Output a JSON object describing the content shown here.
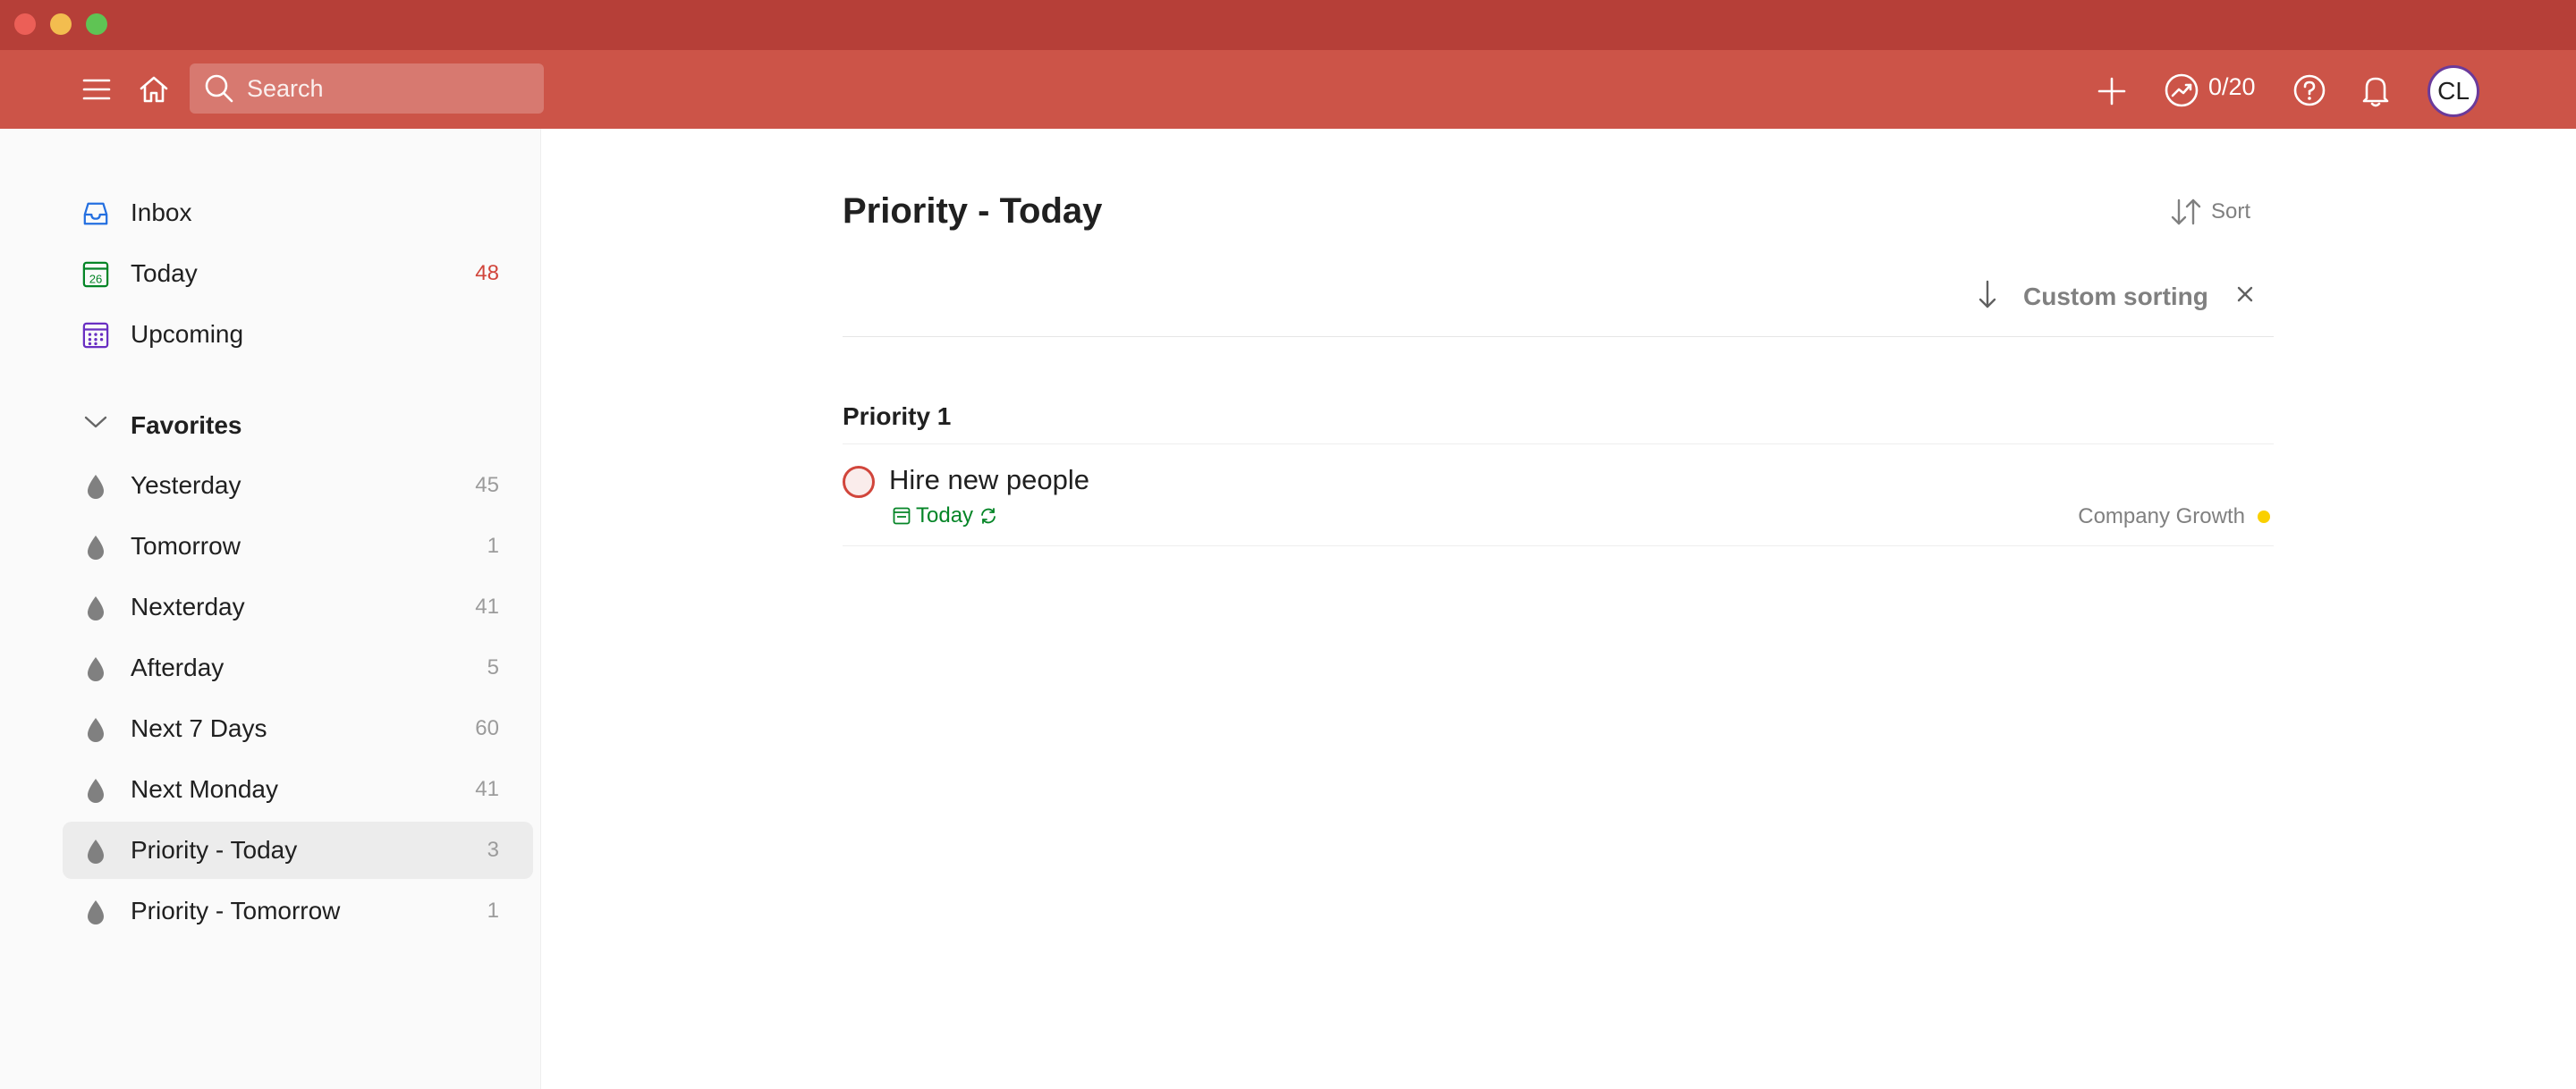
{
  "window": {
    "controls": [
      "close",
      "minimize",
      "zoom"
    ]
  },
  "toolbar": {
    "search_placeholder": "Search",
    "karma": "0/20",
    "avatar_initials": "CL",
    "icons": [
      "menu-icon",
      "home-icon",
      "search-icon",
      "plus-icon",
      "productivity-icon",
      "help-icon",
      "bell-icon"
    ]
  },
  "sidebar": {
    "top_items": [
      {
        "label": "Inbox",
        "count": "",
        "icon": "inbox-icon"
      },
      {
        "label": "Today",
        "count": "48",
        "icon": "calendar-today-icon",
        "day": "26"
      },
      {
        "label": "Upcoming",
        "count": "",
        "icon": "calendar-upcoming-icon"
      }
    ],
    "favorites_label": "Favorites",
    "favorites": [
      {
        "label": "Yesterday",
        "count": "45"
      },
      {
        "label": "Tomorrow",
        "count": "1"
      },
      {
        "label": "Nexterday",
        "count": "41"
      },
      {
        "label": "Afterday",
        "count": "5"
      },
      {
        "label": "Next 7 Days",
        "count": "60"
      },
      {
        "label": "Next Monday",
        "count": "41"
      },
      {
        "label": "Priority - Today",
        "count": "3",
        "active": true
      },
      {
        "label": "Priority - Tomorrow",
        "count": "1"
      }
    ]
  },
  "main": {
    "title": "Priority - Today",
    "sort_label": "Sort",
    "custom_sorting_label": "Custom sorting",
    "sections": [
      {
        "title": "Priority 1",
        "tasks": [
          {
            "name": "Hire new people",
            "due": "Today",
            "recurring": true,
            "project": "Company Growth",
            "project_color": "#fad000"
          }
        ]
      }
    ]
  },
  "colors": {
    "titlebar": "#b63f38",
    "toolbar": "#cc5448",
    "accent_red": "#d1453b",
    "due_green": "#058527"
  }
}
